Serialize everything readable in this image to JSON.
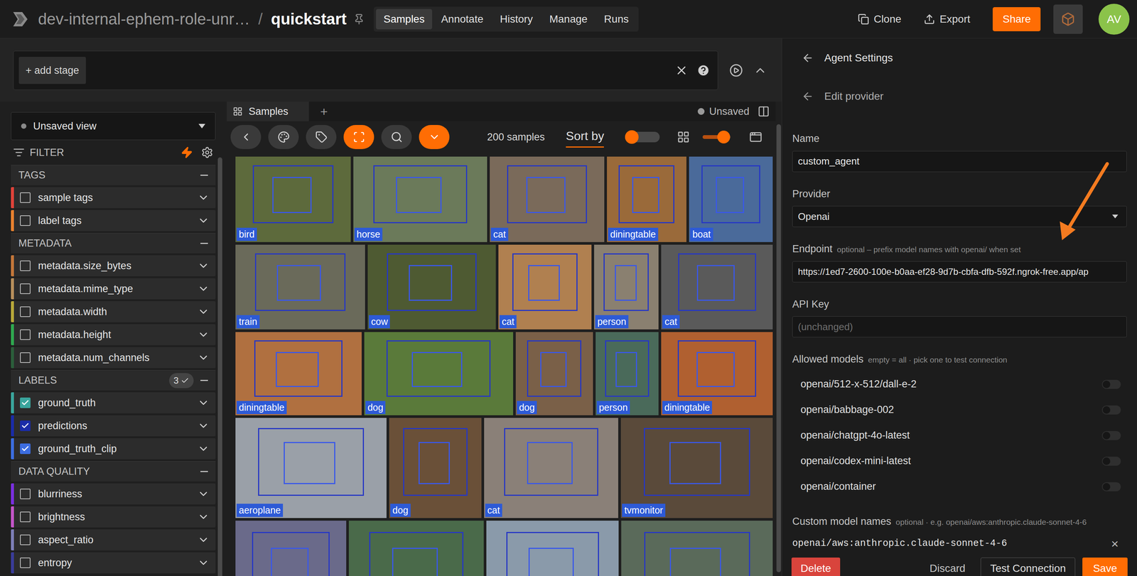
{
  "topbar": {
    "org": "dev-internal-ephem-role-unr…",
    "separator": "/",
    "dataset": "quickstart",
    "nav": [
      {
        "label": "Samples",
        "selected": true
      },
      {
        "label": "Annotate",
        "selected": false
      },
      {
        "label": "History",
        "selected": false
      },
      {
        "label": "Manage",
        "selected": false
      },
      {
        "label": "Runs",
        "selected": false
      }
    ],
    "actions": [
      {
        "label": "Clone",
        "kind": "clone"
      },
      {
        "label": "Export",
        "kind": "export"
      }
    ],
    "share": "Share",
    "avatar": "AV"
  },
  "stages": {
    "add": "+ add stage"
  },
  "sidebar": {
    "view": "Unsaved view",
    "filter": "FILTER",
    "sections": [
      {
        "title": "TAGS",
        "items": [
          {
            "label": "sample tags",
            "checked": false,
            "color": "#e0433a"
          },
          {
            "label": "label tags",
            "checked": false,
            "color": "#e8812f"
          }
        ]
      },
      {
        "title": "METADATA",
        "items": [
          {
            "label": "metadata.size_bytes",
            "checked": false,
            "color": "#c4773a"
          },
          {
            "label": "metadata.mime_type",
            "checked": false,
            "color": "#b88f5c"
          },
          {
            "label": "metadata.width",
            "checked": false,
            "color": "#b8a83a"
          },
          {
            "label": "metadata.height",
            "checked": false,
            "color": "#2fa84f"
          },
          {
            "label": "metadata.num_channels",
            "checked": false,
            "color": "#2b5e3b"
          }
        ]
      },
      {
        "title": "LABELS",
        "badge": "3",
        "items": [
          {
            "label": "ground_truth",
            "checked": true,
            "color": "#3aa59d"
          },
          {
            "label": "predictions",
            "checked": true,
            "color": "#1a2ca8"
          },
          {
            "label": "ground_truth_clip",
            "checked": true,
            "color": "#3c6de0"
          }
        ]
      },
      {
        "title": "DATA QUALITY",
        "items": [
          {
            "label": "blurriness",
            "checked": false,
            "color": "#7a2fe0"
          },
          {
            "label": "brightness",
            "checked": false,
            "color": "#c455c8"
          },
          {
            "label": "aspect_ratio",
            "checked": false,
            "color": "#7d7fb8"
          },
          {
            "label": "entropy",
            "checked": false,
            "color": "#3a3c99"
          }
        ]
      }
    ]
  },
  "grid": {
    "tab": "Samples",
    "add_tab": "+",
    "status": "Unsaved",
    "tools": [
      {
        "kind": "back",
        "active": false
      },
      {
        "kind": "palette",
        "active": false
      },
      {
        "kind": "tag",
        "active": false
      },
      {
        "kind": "select",
        "active": true
      },
      {
        "kind": "search",
        "active": false
      },
      {
        "kind": "more",
        "active": true
      }
    ],
    "count": "200 samples",
    "sort": "Sort by",
    "toggle": {
      "on": false
    },
    "zoom": {
      "level": 0.75
    },
    "rows": [
      {
        "samples": [
          {
            "label": "bird"
          },
          {
            "label": "horse"
          },
          {
            "label": "cat"
          },
          {
            "label": "diningtable"
          },
          {
            "label": "boat"
          }
        ]
      },
      {
        "samples": [
          {
            "label": "train"
          },
          {
            "label": "cow"
          },
          {
            "label": "cat"
          },
          {
            "label": "person"
          },
          {
            "label": "cat"
          }
        ]
      },
      {
        "samples": [
          {
            "label": "diningtable"
          },
          {
            "label": "dog"
          },
          {
            "label": "dog"
          },
          {
            "label": "person"
          },
          {
            "label": "diningtable"
          }
        ]
      },
      {
        "samples": [
          {
            "label": "aeroplane"
          },
          {
            "label": "dog"
          },
          {
            "label": "cat"
          },
          {
            "label": "tvmonitor"
          }
        ]
      },
      {
        "samples": [
          {},
          {},
          {},
          {}
        ]
      }
    ]
  },
  "panel": {
    "title": "Agent Settings",
    "subtitle": "Edit provider",
    "name": {
      "label": "Name",
      "value": "custom_agent"
    },
    "provider": {
      "label": "Provider",
      "value": "Openai"
    },
    "endpoint": {
      "label": "Endpoint",
      "hint": "optional – prefix model names with openai/ when set",
      "value": "https://1ed7-2600-100e-b0aa-ef28-9d7b-cbfa-dfb-592f.ngrok-free.app/ap"
    },
    "api_key": {
      "label": "API Key",
      "placeholder": "(unchanged)"
    },
    "allowed": {
      "label": "Allowed models",
      "hint": "empty = all · pick one to test connection",
      "models": [
        {
          "name": "openai/512-x-512/dall-e-2",
          "on": false
        },
        {
          "name": "openai/babbage-002",
          "on": false
        },
        {
          "name": "openai/chatgpt-4o-latest",
          "on": false
        },
        {
          "name": "openai/codex-mini-latest",
          "on": false
        },
        {
          "name": "openai/container",
          "on": false
        }
      ]
    },
    "custom": {
      "label": "Custom model names",
      "hint": "optional · e.g. openai/aws:anthropic.claude-sonnet-4-6",
      "value": "openai/aws:anthropic.claude-sonnet-4-6",
      "clear": "×"
    },
    "buttons": {
      "delete": "Delete",
      "discard": "Discard",
      "test": "Test Connection",
      "save": "Save"
    }
  }
}
